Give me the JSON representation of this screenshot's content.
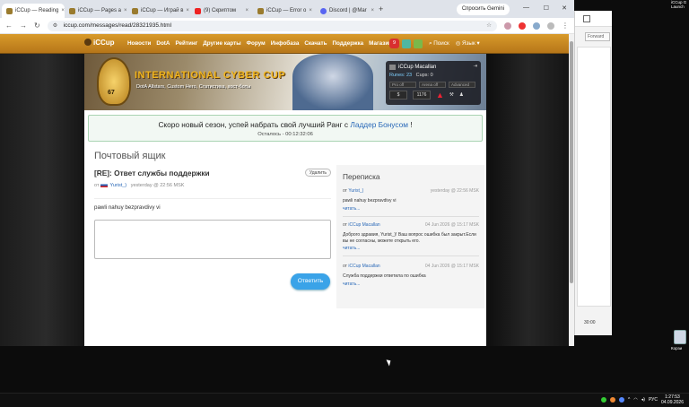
{
  "browser": {
    "tabs": [
      {
        "label": "iCCup — Reading"
      },
      {
        "label": "iCCup — Pages a"
      },
      {
        "label": "iCCup — Играй в"
      },
      {
        "label": "(9) Скриптом"
      },
      {
        "label": "iCCup — Error o"
      },
      {
        "label": "Discord | @Mar"
      }
    ],
    "new_tab": "+",
    "gemini": "Спросить Gemini",
    "url": "iccup.com/messages/read/28321935.html",
    "minimize": "—",
    "maximize": "☐",
    "close": "✕"
  },
  "site": {
    "logo": "iCCup",
    "menu": [
      "Новости",
      "DotA",
      "Рейтинг",
      "Другие карты",
      "Форум",
      "Инфобаза",
      "Скачать",
      "Поддержка",
      "Магазин"
    ],
    "notif_count": "9",
    "search": "Поиск",
    "lang": "Язык"
  },
  "banner": {
    "title": "INTERNATIONAL CYBER CUP",
    "subtitle": "DotA Allstars, Custom Hero, Статистика, хост-боты",
    "trophy": "67"
  },
  "user": {
    "name": "iCCup Macallan",
    "runes_label": "Runes: 23",
    "cups_label": "Cups: 0",
    "pills": [
      "Pro off",
      "Arena off",
      "Advanced"
    ],
    "btm": [
      "$",
      "1176"
    ]
  },
  "notice": {
    "text": "Скоро новый сезон, успей набрать свой лучший Ранг с ",
    "link": "Ладдер Бонусом",
    "tail": " !",
    "timer": "Осталось - 00:12:32:06"
  },
  "mailbox": {
    "title": "Почтовый ящик",
    "message_title": "[RE]: Ответ службы поддержки",
    "delete": "Удалить",
    "from_prefix": "от",
    "author": "Yurist_)",
    "time": "yesterday @ 22:56 MSK",
    "body": "pawli nahuy bezpravdivy vi",
    "send": "Ответить"
  },
  "correspondence": {
    "title": "Переписка",
    "items": [
      {
        "from": "от",
        "author": "Yurist_)",
        "date": "yesterday @ 22:56 MSK",
        "text": "pawli nahuy bezpravdivy vi",
        "read": "читать..."
      },
      {
        "from": "от",
        "author": "iCCup Macallan",
        "date": "04 Jun 2026 @ 15:17 MSK",
        "text": "Доброго здравия, Yurist_)! Ваш вопрос ошибка был закрыт.Если вы не согласны, можете открыть его.",
        "read": "читать..."
      },
      {
        "from": "от",
        "author": "iCCup Macallan",
        "date": "04 Jun 2026 @ 15:17 MSK",
        "text": "Служба поддержки ответила по ошибка",
        "read": "читать..."
      }
    ]
  },
  "side_window": {
    "forward": "Forward",
    "time": "30:00"
  },
  "desktop": {
    "notif": "iCCup G Launch",
    "bin": "Корзи"
  },
  "taskbar": {
    "lang": "РУС",
    "time": "1:27:53",
    "date": "04.09.2026"
  }
}
